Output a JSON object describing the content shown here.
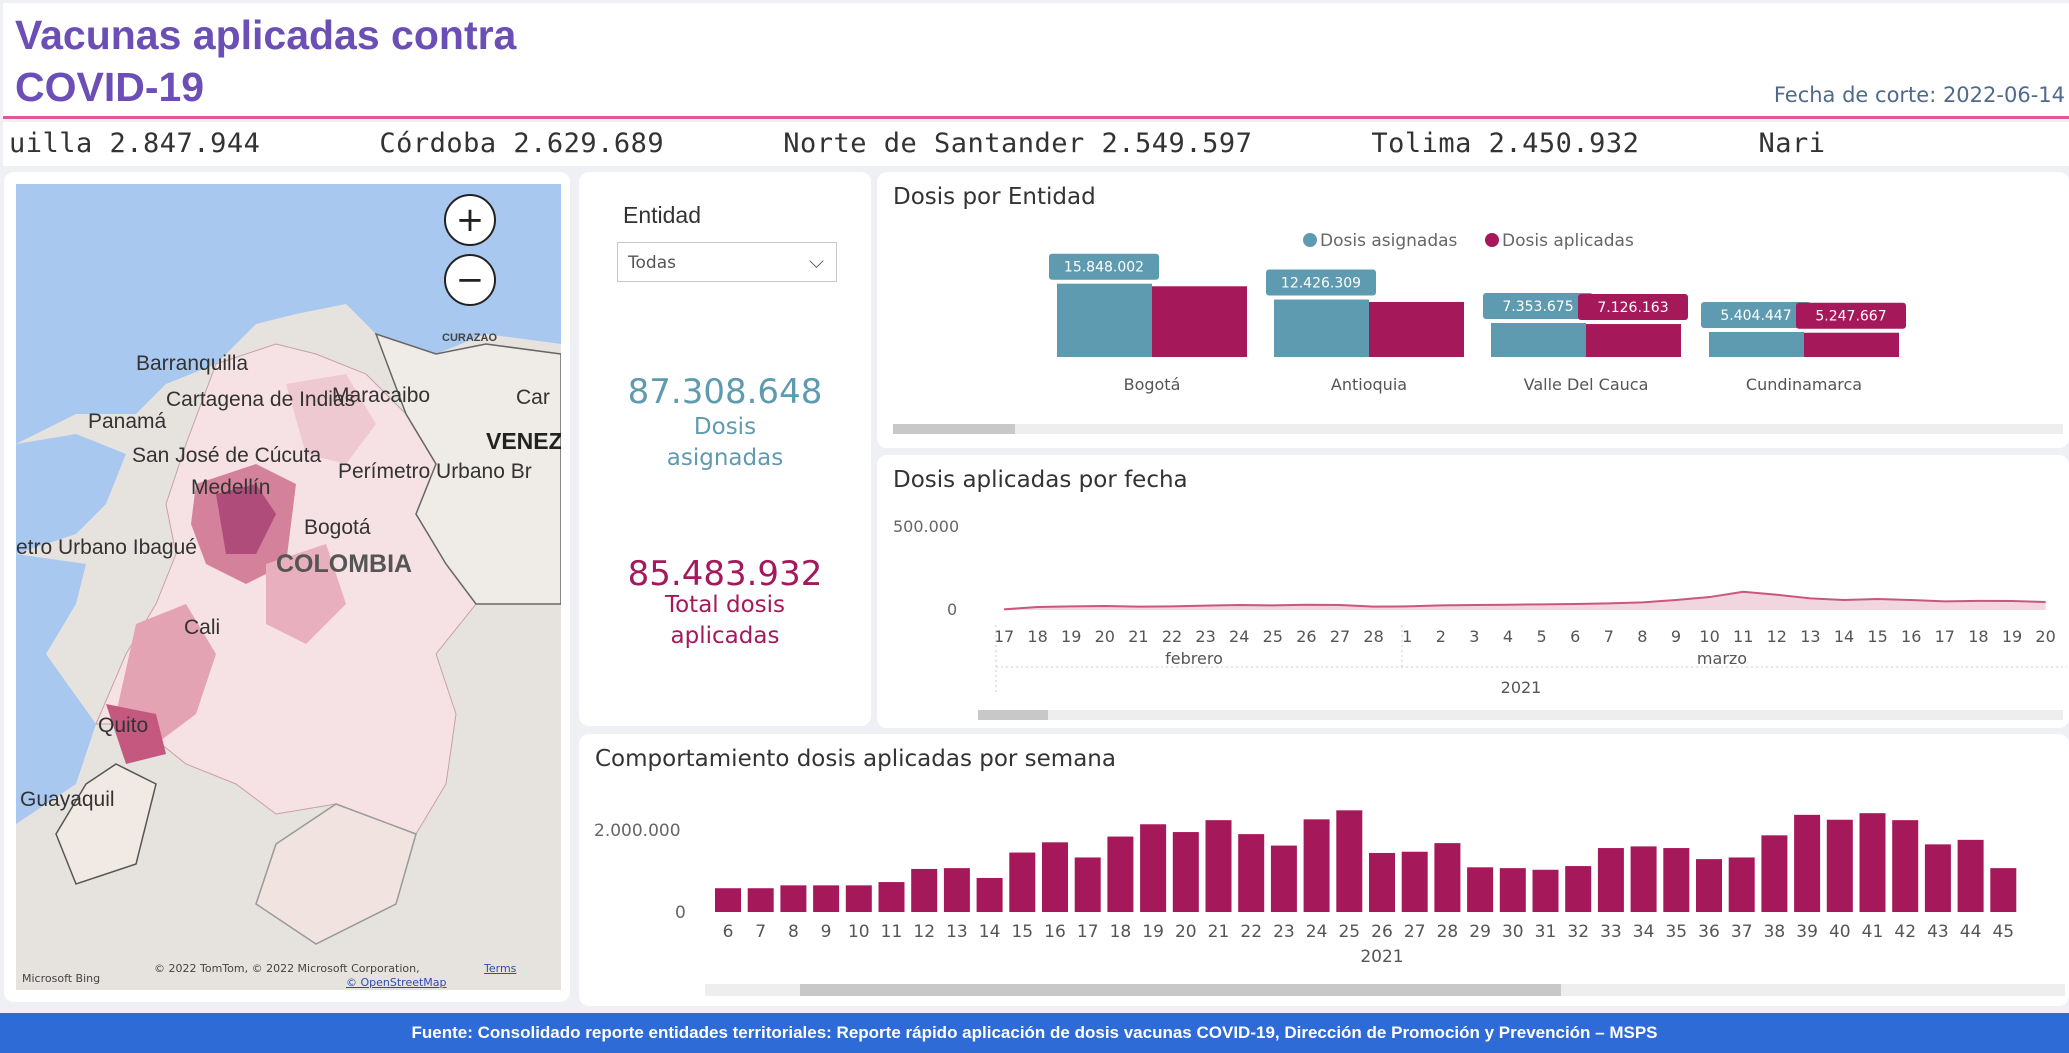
{
  "header": {
    "title": "Vacunas aplicadas contra COVID-19",
    "cutoff": "Fecha de corte: 2022-06-14"
  },
  "ticker": {
    "items": [
      "uilla 2.847.944",
      "Córdoba 2.629.689",
      "Norte de Santander 2.549.597",
      "Tolima 2.450.932",
      "Nari"
    ]
  },
  "map": {
    "zoom_in": "+",
    "zoom_out": "−",
    "labels": {
      "barranquilla": "Barranquilla",
      "curazao": "CURAZAO",
      "cartagena": "Cartagena de Indias",
      "maracaibo": "Maracaibo",
      "caracas": "Car",
      "panama": "Panamá",
      "venezuela": "VENEZ",
      "cucuta": "San José de Cúcuta",
      "medellin": "Medellín",
      "perimetro": "Perímetro Urbano Br",
      "bogota": "Bogotá",
      "ibague": "etro Urbano Ibagué",
      "colombia": "COLOMBIA",
      "cali": "Cali",
      "quito": "Quito",
      "guayaquil": "Guayaquil"
    },
    "attribution": "© 2022 TomTom, © 2022 Microsoft Corporation,",
    "terms": "Terms",
    "osm": "© OpenStreetMap",
    "bing": "Microsoft Bing"
  },
  "filter": {
    "label": "Entidad",
    "selected": "Todas"
  },
  "kpis": {
    "asignadas_value": "87.308.648",
    "asignadas_label": "Dosis asignadas",
    "aplicadas_value": "85.483.932",
    "aplicadas_label": "Total dosis aplicadas"
  },
  "colors": {
    "teal": "#5f9bb0",
    "crimson": "#a5195a",
    "accent": "#6b4fb6",
    "footer": "#2e6bd6"
  },
  "chart_data": [
    {
      "type": "bar",
      "title": "Dosis por Entidad",
      "legend": "top-center",
      "categories": [
        "Bogotá",
        "Antioquia",
        "Valle Del Cauca",
        "Cundinamarca"
      ],
      "series": [
        {
          "name": "Dosis asignadas",
          "color": "#5f9bb0",
          "values": [
            15848002,
            12426309,
            7353675,
            5404447
          ],
          "labels": [
            "15.848.002",
            "12.426.309",
            "7.353.675",
            "5.404.447"
          ]
        },
        {
          "name": "Dosis aplicadas",
          "color": "#a5195a",
          "values": [
            15290000,
            11900000,
            7126163,
            5247667
          ],
          "labels": [
            "",
            "",
            "7.126.163",
            "5.247.667"
          ]
        }
      ]
    },
    {
      "type": "area",
      "title": "Dosis aplicadas por fecha",
      "y_ticks": [
        "500.000",
        "0"
      ],
      "ylim": [
        0,
        500000
      ],
      "x": [
        "17",
        "18",
        "19",
        "20",
        "21",
        "22",
        "23",
        "24",
        "25",
        "26",
        "27",
        "28",
        "1",
        "2",
        "3",
        "4",
        "5",
        "6",
        "7",
        "8",
        "9",
        "10",
        "11",
        "12",
        "13",
        "14",
        "15",
        "16",
        "17",
        "18",
        "19",
        "20"
      ],
      "values": [
        4000,
        18000,
        22000,
        24000,
        20000,
        22000,
        26000,
        30000,
        28000,
        32000,
        30000,
        20000,
        22000,
        28000,
        30000,
        32000,
        34000,
        36000,
        40000,
        46000,
        60000,
        78000,
        110000,
        92000,
        70000,
        60000,
        66000,
        60000,
        52000,
        55000,
        54000,
        48000
      ],
      "months": [
        "febrero",
        "marzo"
      ],
      "year": "2021"
    },
    {
      "type": "bar",
      "title": "Comportamiento dosis aplicadas por semana",
      "y_ticks": [
        "2.000.000",
        "0"
      ],
      "ylim": [
        0,
        2000000
      ],
      "categories": [
        "6",
        "7",
        "8",
        "9",
        "10",
        "11",
        "12",
        "13",
        "14",
        "15",
        "16",
        "17",
        "18",
        "19",
        "20",
        "21",
        "22",
        "23",
        "24",
        "25",
        "26",
        "27",
        "28",
        "29",
        "30",
        "31",
        "32",
        "33",
        "34",
        "35",
        "36",
        "37",
        "38",
        "39",
        "40",
        "41",
        "42",
        "43",
        "44",
        "45"
      ],
      "values": [
        580000,
        580000,
        650000,
        650000,
        650000,
        730000,
        1050000,
        1070000,
        830000,
        1450000,
        1700000,
        1330000,
        1840000,
        2140000,
        1950000,
        2240000,
        1900000,
        1620000,
        2260000,
        2480000,
        1440000,
        1470000,
        1680000,
        1090000,
        1070000,
        1030000,
        1120000,
        1560000,
        1600000,
        1560000,
        1290000,
        1330000,
        1870000,
        2370000,
        2250000,
        2410000,
        2240000,
        1650000,
        1760000,
        1070000
      ],
      "xlabel": "2021",
      "color": "#a5195a"
    }
  ],
  "footer": {
    "text": "Fuente: Consolidado reporte entidades territoriales: Reporte rápido aplicación de dosis vacunas COVID-19, Dirección de Promoción y Prevención – MSPS"
  }
}
